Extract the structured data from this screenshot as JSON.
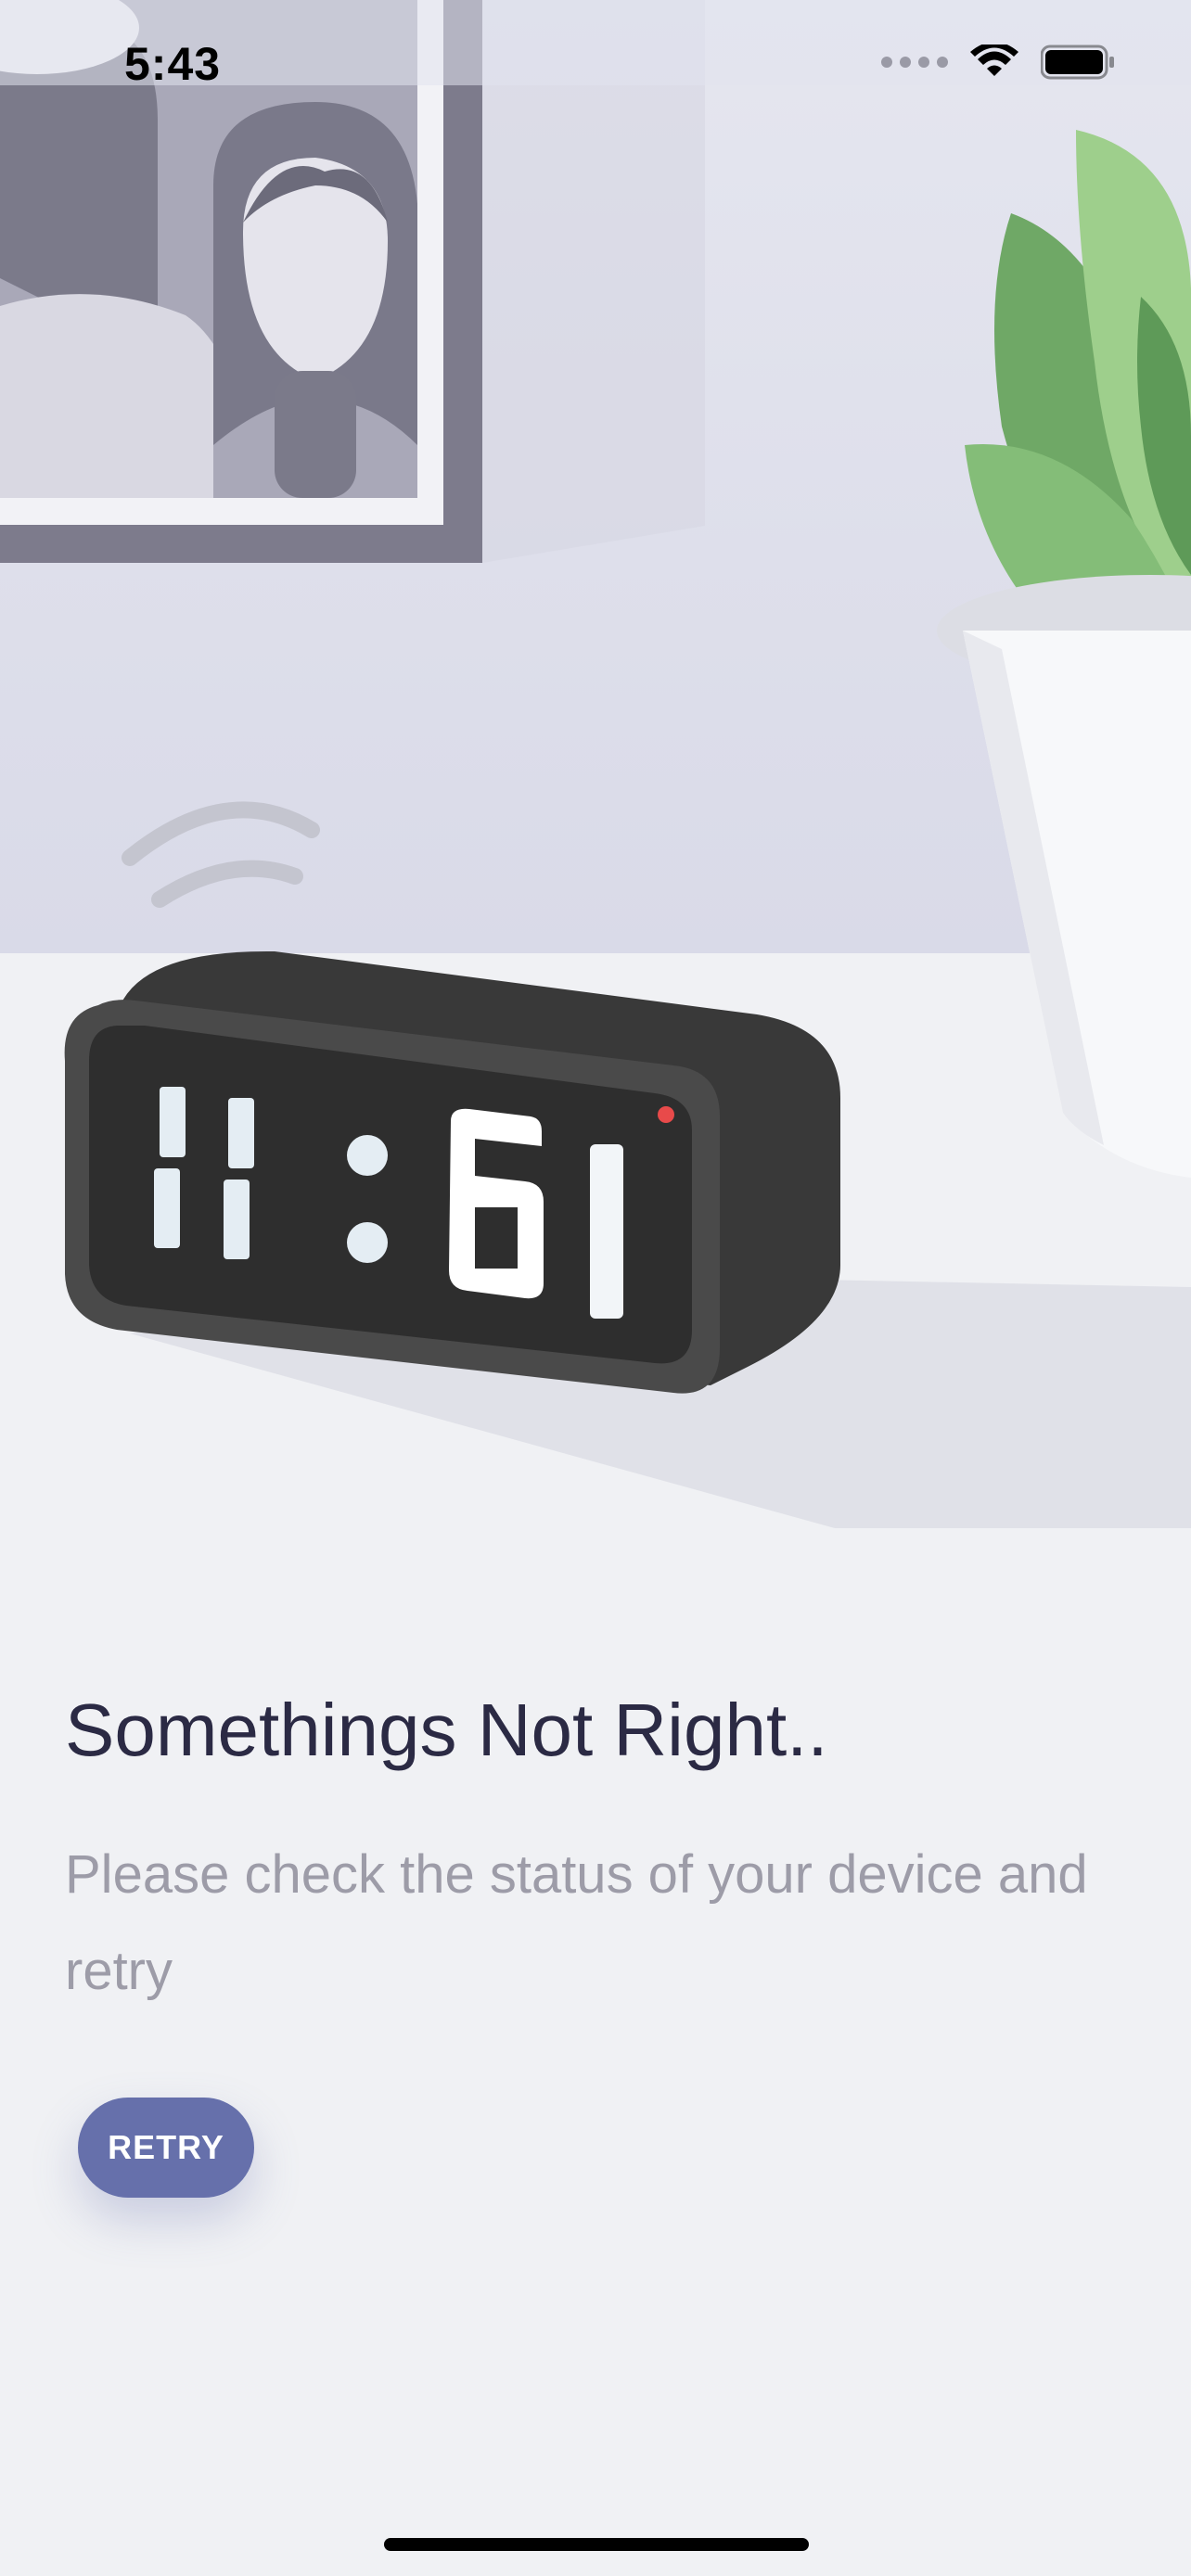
{
  "status_bar": {
    "time": "5:43",
    "icons": [
      "cellular-signal-icon",
      "wifi-icon",
      "battery-icon"
    ]
  },
  "illustration": {
    "clock_display": "11:61"
  },
  "error": {
    "title": "Somethings Not Right..",
    "message": "Please check the status of your device and retry"
  },
  "retry_button": {
    "label": "RETRY"
  },
  "colors": {
    "accent": "#6670ab",
    "title_text": "#2b2a44",
    "body_text": "#9d9ca8",
    "background": "#f0f1f4"
  }
}
